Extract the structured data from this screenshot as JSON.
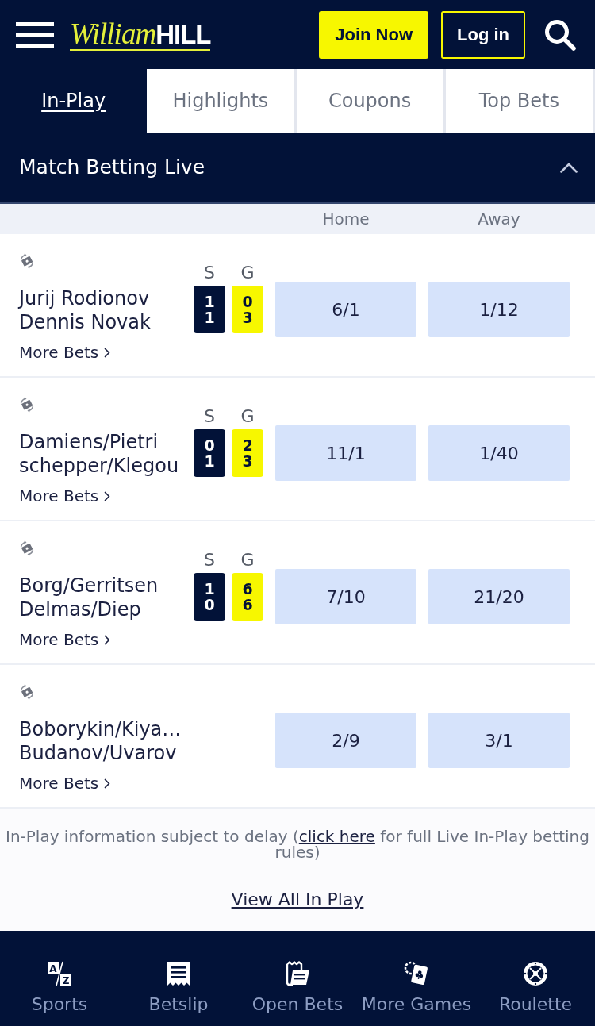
{
  "header": {
    "logo": {
      "script": "William",
      "block": "HILL"
    },
    "buttons": [
      {
        "label": "Join Now",
        "kind": "primary"
      },
      {
        "label": "Log in",
        "kind": "outline"
      }
    ]
  },
  "tabs": [
    {
      "label": "In-Play",
      "selected": true
    },
    {
      "label": "Highlights",
      "selected": false
    },
    {
      "label": "Coupons",
      "selected": false
    },
    {
      "label": "Top Bets",
      "selected": false
    }
  ],
  "section": {
    "title": "Match Betting Live",
    "expanded": true,
    "columns": [
      "Home",
      "Away"
    ],
    "events": [
      {
        "players": [
          "Jurij Rodionov",
          "Dennis Novak"
        ],
        "more_bets": "More Bets",
        "scores": [
          {
            "label": "S",
            "kind": "sets",
            "values": [
              "1",
              "1"
            ]
          },
          {
            "label": "G",
            "kind": "games",
            "values": [
              "0",
              "3"
            ]
          }
        ],
        "odds": [
          "6/1",
          "1/12"
        ]
      },
      {
        "players": [
          "Damiens/Pietri",
          "schepper/Klegou"
        ],
        "more_bets": "More Bets",
        "scores": [
          {
            "label": "S",
            "kind": "sets",
            "values": [
              "0",
              "1"
            ]
          },
          {
            "label": "G",
            "kind": "games",
            "values": [
              "2",
              "3"
            ]
          }
        ],
        "odds": [
          "11/1",
          "1/40"
        ]
      },
      {
        "players": [
          "Borg/Gerritsen",
          "Delmas/Diep"
        ],
        "more_bets": "More Bets",
        "scores": [
          {
            "label": "S",
            "kind": "sets",
            "values": [
              "1",
              "0"
            ]
          },
          {
            "label": "G",
            "kind": "games",
            "values": [
              "6",
              "6"
            ]
          }
        ],
        "odds": [
          "7/10",
          "21/20"
        ]
      },
      {
        "players": [
          "Boborykin/Kiya…",
          "Budanov/Uvarov"
        ],
        "more_bets": "More Bets",
        "odds": [
          "2/9",
          "3/1"
        ]
      }
    ]
  },
  "notice": {
    "before": "In-Play information subject to delay (",
    "link": "click here",
    "after": " for full Live In-Play betting rules)"
  },
  "view_all": "View All In Play",
  "bottom_nav": [
    {
      "label": "Sports",
      "icon_text": [
        "A",
        "Z"
      ]
    },
    {
      "label": "Betslip"
    },
    {
      "label": "Open Bets"
    },
    {
      "label": "More Games"
    },
    {
      "label": "Roulette"
    }
  ]
}
